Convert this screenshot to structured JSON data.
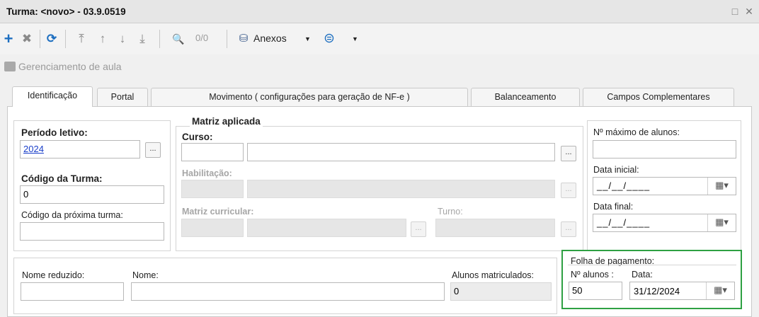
{
  "window": {
    "title": "Turma: <novo> - 03.9.0519",
    "maximize_icon": "□",
    "close_icon": "✕"
  },
  "toolbar": {
    "add_icon": "+",
    "delete_icon": "✖",
    "refresh_icon": "⟳",
    "first_icon": "⤒",
    "up_icon": "↑",
    "down_icon": "↓",
    "last_icon": "⤓",
    "search_icon": "🔍",
    "counter": "0/0",
    "attachments_label": "Anexos",
    "dropdown_icon": "▼",
    "globe_icon": "⊜"
  },
  "subheader": {
    "label": "Gerenciamento de aula"
  },
  "tabs": [
    {
      "label": "Identificação"
    },
    {
      "label": "Portal"
    },
    {
      "label": "Movimento ( configurações para geração de NF-e )"
    },
    {
      "label": "Balanceamento"
    },
    {
      "label": "Campos Complementares"
    }
  ],
  "form": {
    "periodo_label": "Período letivo:",
    "periodo_value": "2024",
    "codigo_label": "Código da Turma:",
    "codigo_value": "0",
    "proxima_label": "Código da próxima turma:",
    "proxima_value": "",
    "matriz_title": "Matriz aplicada",
    "curso_label": "Curso:",
    "habilitacao_label": "Habilitação:",
    "matriz_curricular_label": "Matriz curricular:",
    "turno_label": "Turno:",
    "max_alunos_label": "Nº máximo de alunos:",
    "max_alunos_value": "",
    "data_inicial_label": "Data inicial:",
    "data_inicial_value": "__/__/____",
    "data_final_label": "Data final:",
    "data_final_value": "__/__/____",
    "nome_reduzido_label": "Nome reduzido:",
    "nome_label": "Nome:",
    "alunos_matriculados_label": "Alunos matriculados:",
    "alunos_matriculados_value": "0",
    "folha_title": "Folha de pagamento:",
    "folha_alunos_label": "Nº alunos :",
    "folha_alunos_value": "50",
    "folha_data_label": "Data:",
    "folha_data_value": "31/12/2024",
    "dots": "..."
  },
  "colors": {
    "highlight_border": "#2ea043",
    "link": "#1a3fc9"
  }
}
